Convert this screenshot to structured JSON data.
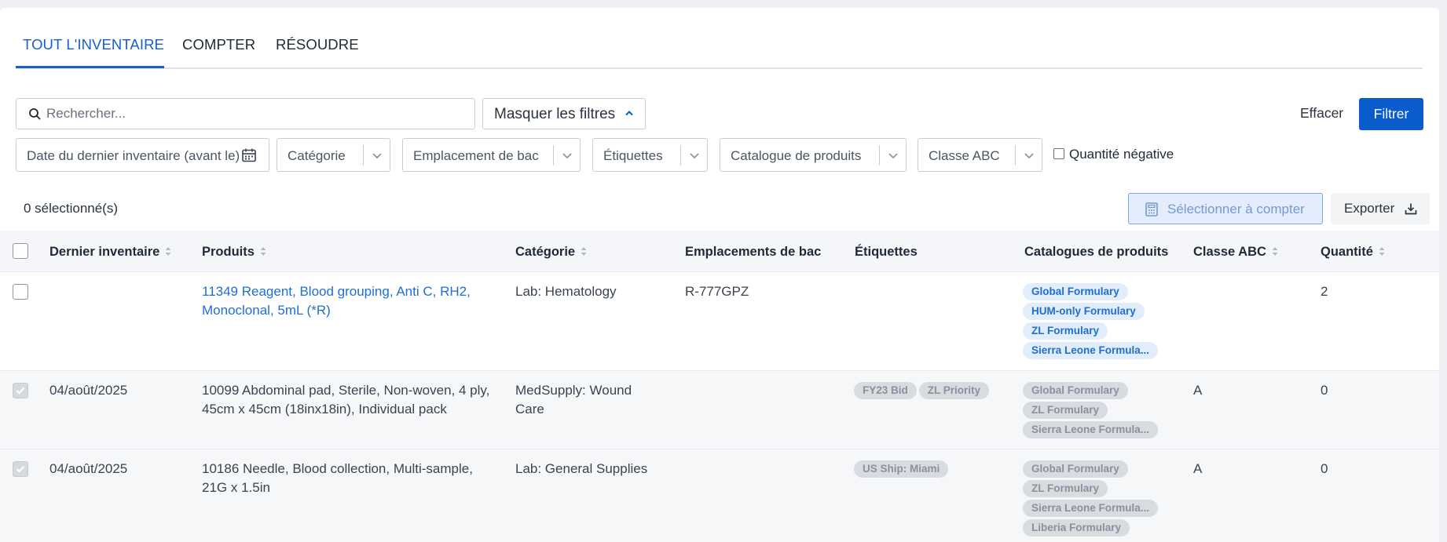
{
  "tabs": [
    {
      "label": "TOUT L'INVENTAIRE",
      "active": true
    },
    {
      "label": "COMPTER",
      "active": false
    },
    {
      "label": "RÉSOUDRE",
      "active": false
    }
  ],
  "search": {
    "placeholder": "Rechercher...",
    "value": ""
  },
  "toolbar": {
    "hide_filters_label": "Masquer les filtres",
    "clear_label": "Effacer",
    "filter_label": "Filtrer"
  },
  "filters": {
    "last_inventory_date": "Date du dernier inventaire (avant le)",
    "category": "Catégorie",
    "bin_location": "Emplacement de bac",
    "tags": "Étiquettes",
    "product_catalog": "Catalogue de produits",
    "abc_class": "Classe ABC",
    "negative_quantity": "Quantité négative"
  },
  "selection": {
    "count_label": "0 sélectionné(s)",
    "select_to_count_label": "Sélectionner à compter",
    "export_label": "Exporter"
  },
  "table": {
    "columns": [
      "Dernier inventaire",
      "Produits",
      "Catégorie",
      "Emplacements de bac",
      "Étiquettes",
      "Catalogues de produits",
      "Classe ABC",
      "Quantité"
    ],
    "rows": [
      {
        "checked": false,
        "last_inventory": "",
        "product_line1": "11349 Reagent, Blood grouping, Anti C, RH2,",
        "product_line2": "Monoclonal, 5mL  (*R)",
        "category_line1": "Lab: Hematology",
        "category_line2": "",
        "bin": "R-777GPZ",
        "tags": [],
        "catalogs": [
          "Global Formulary",
          "HUM-only Formulary",
          "ZL Formulary",
          "Sierra Leone Formula..."
        ],
        "abc": "",
        "quantity": "2"
      },
      {
        "checked": true,
        "last_inventory": "04/août/2025",
        "product_line1": "10099 Abdominal pad, Sterile, Non-woven, 4 ply,",
        "product_line2": "45cm x 45cm (18inx18in), Individual pack",
        "category_line1": "MedSupply: Wound",
        "category_line2": "Care",
        "bin": "",
        "tags": [
          "FY23 Bid",
          "ZL Priority"
        ],
        "catalogs": [
          "Global Formulary",
          "ZL Formulary",
          "Sierra Leone Formula..."
        ],
        "abc": "A",
        "quantity": "0"
      },
      {
        "checked": true,
        "last_inventory": "04/août/2025",
        "product_line1": "10186 Needle, Blood collection, Multi-sample,",
        "product_line2": "21G x 1.5in",
        "category_line1": "Lab: General Supplies",
        "category_line2": "",
        "bin": "",
        "tags": [
          "US Ship: Miami"
        ],
        "catalogs": [
          "Global Formulary",
          "ZL Formulary",
          "Sierra Leone Formula...",
          "Liberia Formulary"
        ],
        "abc": "A",
        "quantity": "0"
      }
    ]
  },
  "colors": {
    "accent": "#0a5bcc",
    "link": "#1f6fd0",
    "chip_blue_bg": "#e2edfc",
    "chip_grey_bg": "#d8dbe0"
  },
  "icons": {
    "search": "search-icon",
    "calendar": "calendar-icon",
    "dropdown": "chevron-down-icon",
    "collapse": "chevron-up-icon",
    "sort": "sort-icon",
    "calculator": "calculator-icon",
    "download": "download-icon"
  }
}
